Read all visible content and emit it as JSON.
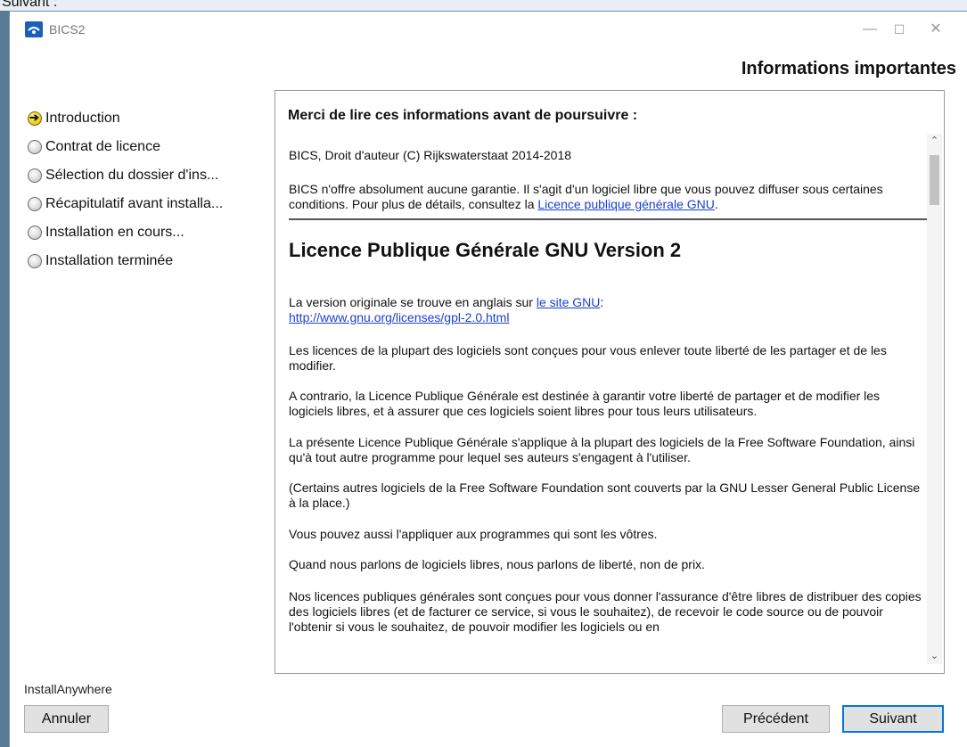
{
  "background": {
    "text": "Suivant :"
  },
  "window": {
    "title": "BICS2",
    "controls": {
      "minimize": "—",
      "maximize": "☐",
      "close": "✕"
    }
  },
  "header": {
    "title": "Informations importantes"
  },
  "steps": [
    {
      "label": "Introduction",
      "active": true
    },
    {
      "label": "Contrat de licence",
      "active": false
    },
    {
      "label": "Sélection du dossier d'ins...",
      "active": false
    },
    {
      "label": "Récapitulatif avant installa...",
      "active": false
    },
    {
      "label": "Installation en cours...",
      "active": false
    },
    {
      "label": "Installation terminée",
      "active": false
    }
  ],
  "panel": {
    "heading": "Merci de lire ces informations avant de poursuivre :",
    "copyright": "BICS, Droit d'auteur (C) Rijkswaterstaat 2014-2018",
    "warranty_text": "BICS n'offre absolument aucune garantie. Il s'agit d'un logiciel libre que vous pouvez diffuser sous certaines conditions. Pour plus de détails, consultez la ",
    "warranty_link": "Licence publique générale GNU",
    "warranty_end": ".",
    "licence_title": "Licence Publique Générale GNU Version 2",
    "original_text": "La version originale se trouve en anglais sur ",
    "original_link": "le site GNU",
    "original_colon": ":",
    "original_url": "http://www.gnu.org/licenses/gpl-2.0.html",
    "paragraphs": [
      "Les licences de la plupart des logiciels sont conçues pour vous enlever toute liberté de les partager et de les modifier.",
      "A contrario, la Licence Publique Générale est destinée à garantir votre liberté de partager et de modifier les logiciels libres, et à assurer que ces logiciels soient libres pour tous leurs utilisateurs.",
      "La présente Licence Publique Générale s'applique à la plupart des logiciels de la Free Software Foundation, ainsi qu'à tout autre programme pour lequel ses auteurs s'engagent à l'utiliser.",
      "(Certains autres logiciels de la Free Software Foundation sont couverts par la GNU Lesser General Public License à la place.)",
      "Vous pouvez aussi l'appliquer aux programmes qui sont les vôtres.",
      "Quand nous parlons de logiciels libres, nous parlons de liberté, non de prix.",
      "Nos licences publiques générales sont conçues pour vous donner l'assurance d'être libres de distribuer des copies des logiciels libres (et de facturer ce service, si vous le souhaitez), de recevoir le code source ou de pouvoir l'obtenir si vous le souhaitez, de pouvoir modifier les logiciels ou en"
    ],
    "scroll_up": "⌃",
    "scroll_down": "⌄"
  },
  "footer": {
    "brand": "InstallAnywhere",
    "cancel": "Annuler",
    "previous": "Précédent",
    "next": "Suivant"
  }
}
